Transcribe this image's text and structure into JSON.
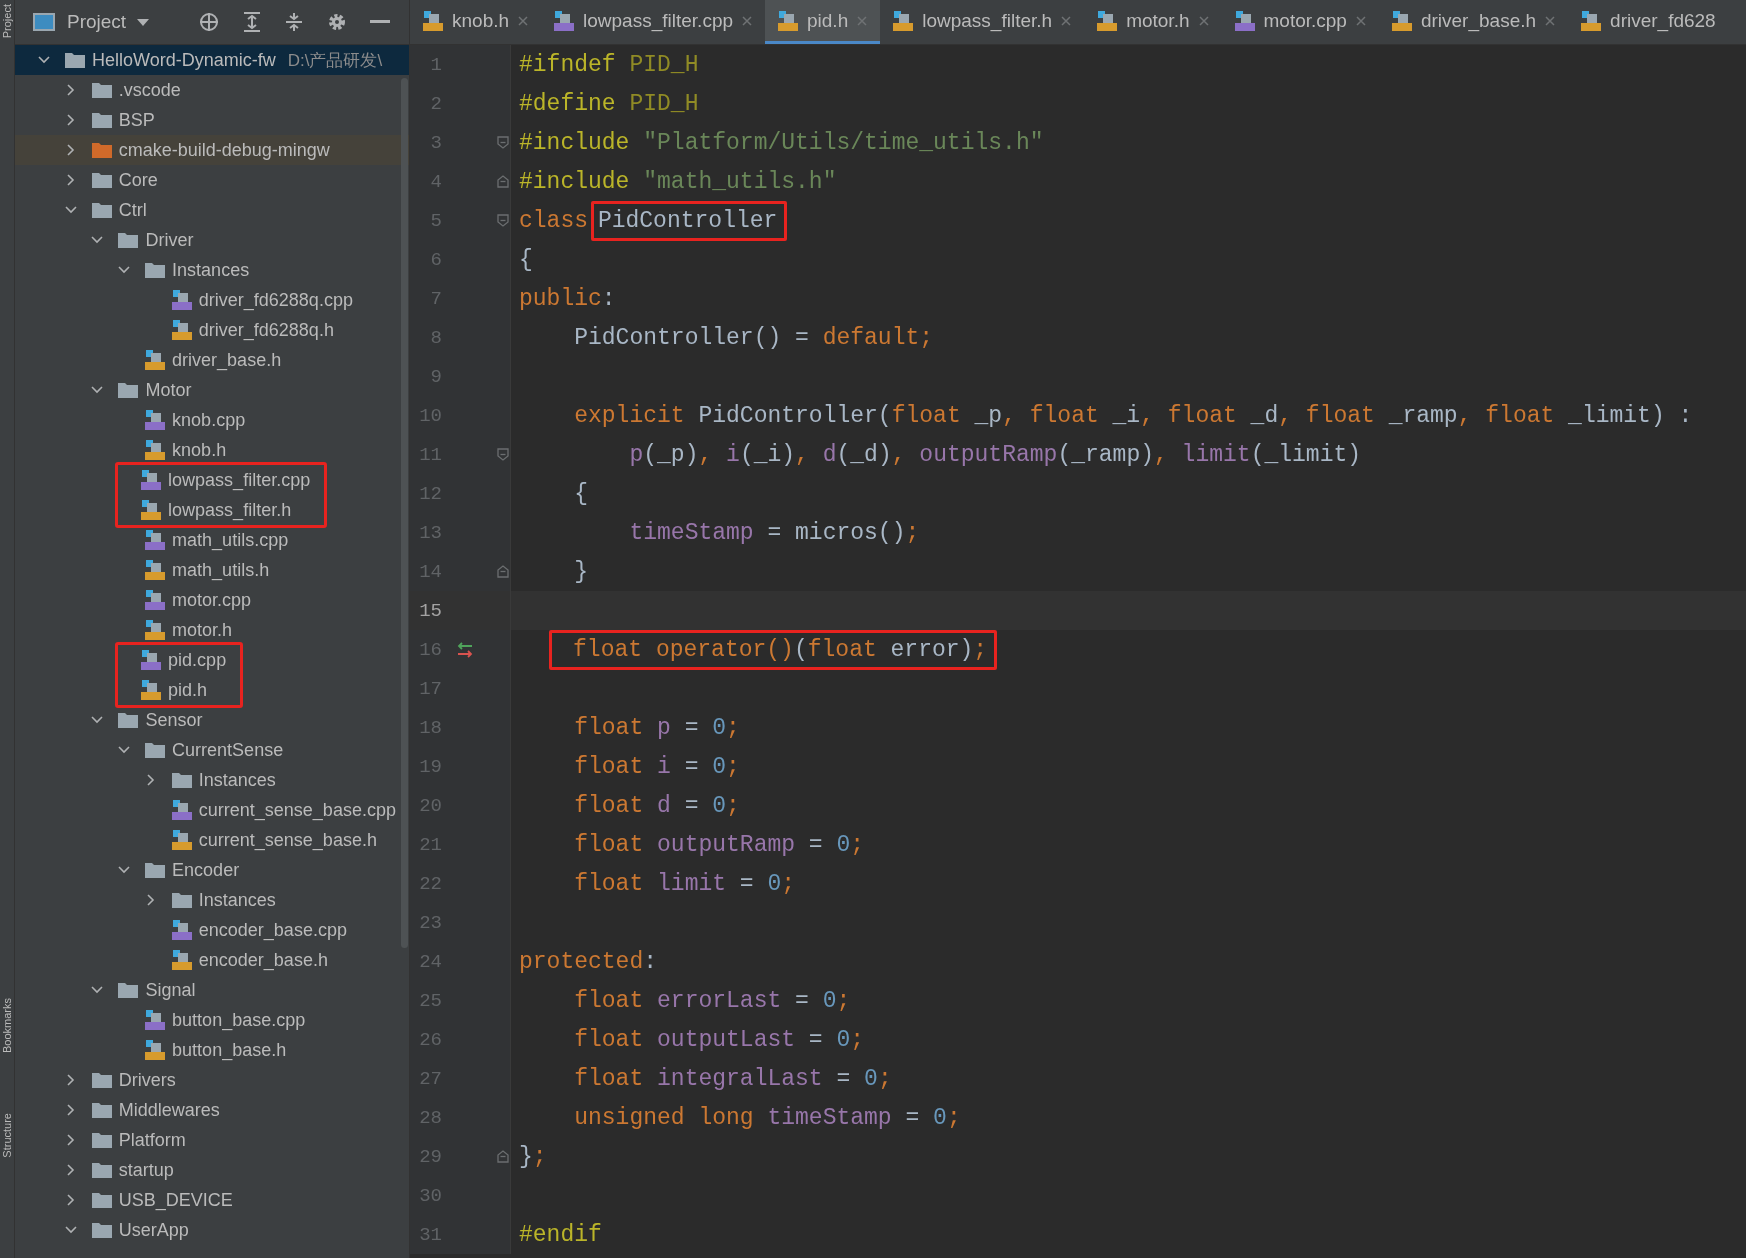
{
  "side_tabs": [
    "Project",
    "Bookmarks",
    "Structure"
  ],
  "project_panel": {
    "title": "Project",
    "tree": [
      {
        "label": "HelloWord-Dynamic-fw",
        "path": "D:\\产品研发\\",
        "kind": "folder",
        "expanded": true,
        "selected": true,
        "children": [
          {
            "label": ".vscode",
            "kind": "folder",
            "expanded": false,
            "selected": false
          },
          {
            "label": "BSP",
            "kind": "folder",
            "expanded": false,
            "selected": false
          },
          {
            "label": "cmake-build-debug-mingw",
            "kind": "build_folder",
            "expanded": false,
            "selected": false
          },
          {
            "label": "Core",
            "kind": "folder",
            "expanded": false,
            "selected": false
          },
          {
            "label": "Ctrl",
            "kind": "folder",
            "expanded": true,
            "selected": false,
            "children": [
              {
                "label": "Driver",
                "kind": "folder",
                "expanded": true,
                "selected": false,
                "children": [
                  {
                    "label": "Instances",
                    "kind": "folder",
                    "expanded": true,
                    "selected": false,
                    "children": [
                      {
                        "label": "driver_fd6288q.cpp",
                        "kind": "cpp",
                        "selected": false
                      },
                      {
                        "label": "driver_fd6288q.h",
                        "kind": "h",
                        "selected": false
                      }
                    ]
                  },
                  {
                    "label": "driver_base.h",
                    "kind": "h",
                    "selected": false
                  }
                ]
              },
              {
                "label": "Motor",
                "kind": "folder",
                "expanded": true,
                "selected": false,
                "children": [
                  {
                    "label": "knob.cpp",
                    "kind": "cpp",
                    "selected": false
                  },
                  {
                    "label": "knob.h",
                    "kind": "h",
                    "selected": false
                  },
                  {
                    "kind": "highlight",
                    "items": [
                      {
                        "label": "lowpass_filter.cpp",
                        "kind": "cpp",
                        "selected": false
                      },
                      {
                        "label": "lowpass_filter.h",
                        "kind": "h",
                        "selected": false
                      }
                    ]
                  },
                  {
                    "label": "math_utils.cpp",
                    "kind": "cpp",
                    "selected": false
                  },
                  {
                    "label": "math_utils.h",
                    "kind": "h",
                    "selected": false
                  },
                  {
                    "label": "motor.cpp",
                    "kind": "cpp",
                    "selected": false
                  },
                  {
                    "label": "motor.h",
                    "kind": "h",
                    "selected": false
                  },
                  {
                    "kind": "highlight",
                    "items": [
                      {
                        "label": "pid.cpp",
                        "kind": "cpp",
                        "selected": false
                      },
                      {
                        "label": "pid.h",
                        "kind": "h",
                        "selected": false
                      }
                    ]
                  }
                ]
              },
              {
                "label": "Sensor",
                "kind": "folder",
                "expanded": true,
                "selected": false,
                "children": [
                  {
                    "label": "CurrentSense",
                    "kind": "folder",
                    "expanded": true,
                    "selected": false,
                    "children": [
                      {
                        "label": "Instances",
                        "kind": "folder",
                        "expanded": false,
                        "selected": false
                      },
                      {
                        "label": "current_sense_base.cpp",
                        "kind": "cpp",
                        "selected": false
                      },
                      {
                        "label": "current_sense_base.h",
                        "kind": "h",
                        "selected": false
                      }
                    ]
                  },
                  {
                    "label": "Encoder",
                    "kind": "folder",
                    "expanded": true,
                    "selected": false,
                    "children": [
                      {
                        "label": "Instances",
                        "kind": "folder",
                        "expanded": false,
                        "selected": false
                      },
                      {
                        "label": "encoder_base.cpp",
                        "kind": "cpp",
                        "selected": false
                      },
                      {
                        "label": "encoder_base.h",
                        "kind": "h",
                        "selected": false
                      }
                    ]
                  }
                ]
              },
              {
                "label": "Signal",
                "kind": "folder",
                "expanded": true,
                "selected": false,
                "children": [
                  {
                    "label": "button_base.cpp",
                    "kind": "cpp",
                    "selected": false
                  },
                  {
                    "label": "button_base.h",
                    "kind": "h",
                    "selected": false
                  }
                ]
              }
            ]
          },
          {
            "label": "Drivers",
            "kind": "folder",
            "expanded": false,
            "selected": false
          },
          {
            "label": "Middlewares",
            "kind": "folder",
            "expanded": false,
            "selected": false
          },
          {
            "label": "Platform",
            "kind": "folder",
            "expanded": false,
            "selected": false
          },
          {
            "label": "startup",
            "kind": "folder",
            "expanded": false,
            "selected": false
          },
          {
            "label": "USB_DEVICE",
            "kind": "folder",
            "expanded": false,
            "selected": false
          },
          {
            "label": "UserApp",
            "kind": "folder",
            "expanded": true,
            "selected": false
          }
        ]
      }
    ]
  },
  "tabs": [
    {
      "label": "knob.h",
      "kind": "h",
      "selected": false,
      "closable": true
    },
    {
      "label": "lowpass_filter.cpp",
      "kind": "cpp",
      "selected": false,
      "closable": true
    },
    {
      "label": "pid.h",
      "kind": "h",
      "selected": true,
      "closable": true
    },
    {
      "label": "lowpass_filter.h",
      "kind": "h",
      "selected": false,
      "closable": true
    },
    {
      "label": "motor.h",
      "kind": "h",
      "selected": false,
      "closable": true
    },
    {
      "label": "motor.cpp",
      "kind": "cpp",
      "selected": false,
      "closable": true
    },
    {
      "label": "driver_base.h",
      "kind": "h",
      "selected": false,
      "closable": true
    },
    {
      "label": "driver_fd628",
      "kind": "h",
      "selected": false,
      "closable": false
    }
  ],
  "editor": {
    "lines": [
      {
        "number": "1",
        "current": false,
        "fold_start": false,
        "fold_end": false,
        "implements": false,
        "tokens": [
          {
            "text": "#ifndef",
            "kind": "preproc"
          },
          {
            "text": " PID_H",
            "kind": "macro"
          }
        ]
      },
      {
        "number": "2",
        "current": false,
        "fold_start": false,
        "fold_end": false,
        "implements": false,
        "tokens": [
          {
            "text": "#define",
            "kind": "preproc"
          },
          {
            "text": " PID_H",
            "kind": "macro"
          }
        ]
      },
      {
        "number": "3",
        "current": false,
        "fold_start": true,
        "fold_end": false,
        "implements": false,
        "tokens": [
          {
            "text": "#include",
            "kind": "preproc"
          },
          {
            "text": " \"Platform/Utils/time_utils.h\"",
            "kind": "string"
          }
        ]
      },
      {
        "number": "4",
        "current": false,
        "fold_start": false,
        "fold_end": true,
        "implements": false,
        "tokens": [
          {
            "text": "#include",
            "kind": "preproc"
          },
          {
            "text": " \"math_utils.h\"",
            "kind": "string"
          }
        ]
      },
      {
        "number": "5",
        "current": false,
        "fold_start": true,
        "fold_end": false,
        "implements": false,
        "tokens": [
          {
            "text": "class",
            "kind": "keyword"
          },
          {
            "kind": "box",
            "tokens": [
              {
                "text": "PidController",
                "kind": "plain"
              }
            ]
          }
        ]
      },
      {
        "number": "6",
        "current": false,
        "fold_start": false,
        "fold_end": false,
        "implements": false,
        "tokens": [
          {
            "text": "{",
            "kind": "plain"
          }
        ]
      },
      {
        "number": "7",
        "current": false,
        "fold_start": false,
        "fold_end": false,
        "implements": false,
        "tokens": [
          {
            "text": "public",
            "kind": "keyword"
          },
          {
            "text": ":",
            "kind": "plain"
          }
        ]
      },
      {
        "number": "8",
        "current": false,
        "fold_start": false,
        "fold_end": false,
        "implements": false,
        "tokens": [
          {
            "text": "    PidController() = ",
            "kind": "plain"
          },
          {
            "text": "default;",
            "kind": "keyword"
          }
        ]
      },
      {
        "number": "9",
        "current": false,
        "fold_start": false,
        "fold_end": false,
        "implements": false
      },
      {
        "number": "10",
        "current": false,
        "fold_start": false,
        "fold_end": false,
        "implements": false,
        "tokens": [
          {
            "text": "    explicit",
            "kind": "keyword"
          },
          {
            "text": " PidController(",
            "kind": "plain"
          },
          {
            "text": "float",
            "kind": "keyword"
          },
          {
            "text": " _p",
            "kind": "plain"
          },
          {
            "text": ", ",
            "kind": "keyword"
          },
          {
            "text": "float",
            "kind": "keyword"
          },
          {
            "text": " _i",
            "kind": "plain"
          },
          {
            "text": ", ",
            "kind": "keyword"
          },
          {
            "text": "float",
            "kind": "keyword"
          },
          {
            "text": " _d",
            "kind": "plain"
          },
          {
            "text": ", ",
            "kind": "keyword"
          },
          {
            "text": "float",
            "kind": "keyword"
          },
          {
            "text": " _ramp",
            "kind": "plain"
          },
          {
            "text": ", ",
            "kind": "keyword"
          },
          {
            "text": "float",
            "kind": "keyword"
          },
          {
            "text": " _limit) :",
            "kind": "plain"
          }
        ]
      },
      {
        "number": "11",
        "current": false,
        "fold_start": true,
        "fold_end": false,
        "implements": false,
        "tokens": [
          {
            "text": "        p",
            "kind": "field"
          },
          {
            "text": "(_p)",
            "kind": "plain"
          },
          {
            "text": ", ",
            "kind": "keyword"
          },
          {
            "text": "i",
            "kind": "field"
          },
          {
            "text": "(_i)",
            "kind": "plain"
          },
          {
            "text": ", ",
            "kind": "keyword"
          },
          {
            "text": "d",
            "kind": "field"
          },
          {
            "text": "(_d)",
            "kind": "plain"
          },
          {
            "text": ", ",
            "kind": "keyword"
          },
          {
            "text": "outputRamp",
            "kind": "field"
          },
          {
            "text": "(_ramp)",
            "kind": "plain"
          },
          {
            "text": ", ",
            "kind": "keyword"
          },
          {
            "text": "limit",
            "kind": "field"
          },
          {
            "text": "(_limit)",
            "kind": "plain"
          }
        ]
      },
      {
        "number": "12",
        "current": false,
        "fold_start": false,
        "fold_end": false,
        "implements": false,
        "tokens": [
          {
            "text": "    {",
            "kind": "plain"
          }
        ]
      },
      {
        "number": "13",
        "current": false,
        "fold_start": false,
        "fold_end": false,
        "implements": false,
        "tokens": [
          {
            "text": "        timeStamp",
            "kind": "field"
          },
          {
            "text": " = micros()",
            "kind": "plain"
          },
          {
            "text": ";",
            "kind": "keyword"
          }
        ]
      },
      {
        "number": "14",
        "current": false,
        "fold_start": false,
        "fold_end": true,
        "implements": false,
        "tokens": [
          {
            "text": "    }",
            "kind": "plain"
          }
        ]
      },
      {
        "number": "15",
        "current": true,
        "fold_start": false,
        "fold_end": false,
        "implements": false
      },
      {
        "number": "16",
        "current": false,
        "fold_start": false,
        "fold_end": false,
        "implements": true,
        "tokens": [
          {
            "kind": "block_box",
            "tokens": [
              {
                "text": "float",
                "kind": "keyword"
              },
              {
                "text": " operator()",
                "kind": "keyword"
              },
              {
                "text": "(",
                "kind": "plain"
              },
              {
                "text": "float",
                "kind": "keyword"
              },
              {
                "text": " error)",
                "kind": "plain"
              },
              {
                "text": ";",
                "kind": "keyword"
              }
            ]
          }
        ]
      },
      {
        "number": "17",
        "current": false,
        "fold_start": false,
        "fold_end": false,
        "implements": false
      },
      {
        "number": "18",
        "current": false,
        "fold_start": false,
        "fold_end": false,
        "implements": false,
        "tokens": [
          {
            "text": "    float",
            "kind": "keyword"
          },
          {
            "text": " p",
            "kind": "field"
          },
          {
            "text": " = ",
            "kind": "plain"
          },
          {
            "text": "0",
            "kind": "number"
          },
          {
            "text": ";",
            "kind": "keyword"
          }
        ]
      },
      {
        "number": "19",
        "current": false,
        "fold_start": false,
        "fold_end": false,
        "implements": false,
        "tokens": [
          {
            "text": "    float",
            "kind": "keyword"
          },
          {
            "text": " i",
            "kind": "field"
          },
          {
            "text": " = ",
            "kind": "plain"
          },
          {
            "text": "0",
            "kind": "number"
          },
          {
            "text": ";",
            "kind": "keyword"
          }
        ]
      },
      {
        "number": "20",
        "current": false,
        "fold_start": false,
        "fold_end": false,
        "implements": false,
        "tokens": [
          {
            "text": "    float",
            "kind": "keyword"
          },
          {
            "text": " d",
            "kind": "field"
          },
          {
            "text": " = ",
            "kind": "plain"
          },
          {
            "text": "0",
            "kind": "number"
          },
          {
            "text": ";",
            "kind": "keyword"
          }
        ]
      },
      {
        "number": "21",
        "current": false,
        "fold_start": false,
        "fold_end": false,
        "implements": false,
        "tokens": [
          {
            "text": "    float",
            "kind": "keyword"
          },
          {
            "text": " outputRamp",
            "kind": "field"
          },
          {
            "text": " = ",
            "kind": "plain"
          },
          {
            "text": "0",
            "kind": "number"
          },
          {
            "text": ";",
            "kind": "keyword"
          }
        ]
      },
      {
        "number": "22",
        "current": false,
        "fold_start": false,
        "fold_end": false,
        "implements": false,
        "tokens": [
          {
            "text": "    float",
            "kind": "keyword"
          },
          {
            "text": " limit",
            "kind": "field"
          },
          {
            "text": " = ",
            "kind": "plain"
          },
          {
            "text": "0",
            "kind": "number"
          },
          {
            "text": ";",
            "kind": "keyword"
          }
        ]
      },
      {
        "number": "23",
        "current": false,
        "fold_start": false,
        "fold_end": false,
        "implements": false
      },
      {
        "number": "24",
        "current": false,
        "fold_start": false,
        "fold_end": false,
        "implements": false,
        "tokens": [
          {
            "text": "protected",
            "kind": "keyword"
          },
          {
            "text": ":",
            "kind": "plain"
          }
        ]
      },
      {
        "number": "25",
        "current": false,
        "fold_start": false,
        "fold_end": false,
        "implements": false,
        "tokens": [
          {
            "text": "    float",
            "kind": "keyword"
          },
          {
            "text": " errorLast",
            "kind": "field"
          },
          {
            "text": " = ",
            "kind": "plain"
          },
          {
            "text": "0",
            "kind": "number"
          },
          {
            "text": ";",
            "kind": "keyword"
          }
        ]
      },
      {
        "number": "26",
        "current": false,
        "fold_start": false,
        "fold_end": false,
        "implements": false,
        "tokens": [
          {
            "text": "    float",
            "kind": "keyword"
          },
          {
            "text": " outputLast",
            "kind": "field"
          },
          {
            "text": " = ",
            "kind": "plain"
          },
          {
            "text": "0",
            "kind": "number"
          },
          {
            "text": ";",
            "kind": "keyword"
          }
        ]
      },
      {
        "number": "27",
        "current": false,
        "fold_start": false,
        "fold_end": false,
        "implements": false,
        "tokens": [
          {
            "text": "    float",
            "kind": "keyword"
          },
          {
            "text": " integralLast",
            "kind": "field"
          },
          {
            "text": " = ",
            "kind": "plain"
          },
          {
            "text": "0",
            "kind": "number"
          },
          {
            "text": ";",
            "kind": "keyword"
          }
        ]
      },
      {
        "number": "28",
        "current": false,
        "fold_start": false,
        "fold_end": false,
        "implements": false,
        "tokens": [
          {
            "text": "    unsigned long",
            "kind": "keyword"
          },
          {
            "text": " timeStamp",
            "kind": "field"
          },
          {
            "text": " = ",
            "kind": "plain"
          },
          {
            "text": "0",
            "kind": "number"
          },
          {
            "text": ";",
            "kind": "keyword"
          }
        ]
      },
      {
        "number": "29",
        "current": false,
        "fold_start": false,
        "fold_end": true,
        "implements": false,
        "tokens": [
          {
            "text": "}",
            "kind": "plain"
          },
          {
            "text": ";",
            "kind": "keyword"
          }
        ]
      },
      {
        "number": "30",
        "current": false,
        "fold_start": false,
        "fold_end": false,
        "implements": false
      },
      {
        "number": "31",
        "current": false,
        "fold_start": false,
        "fold_end": false,
        "implements": false,
        "tokens": [
          {
            "text": "#endif",
            "kind": "preproc"
          }
        ]
      }
    ]
  }
}
